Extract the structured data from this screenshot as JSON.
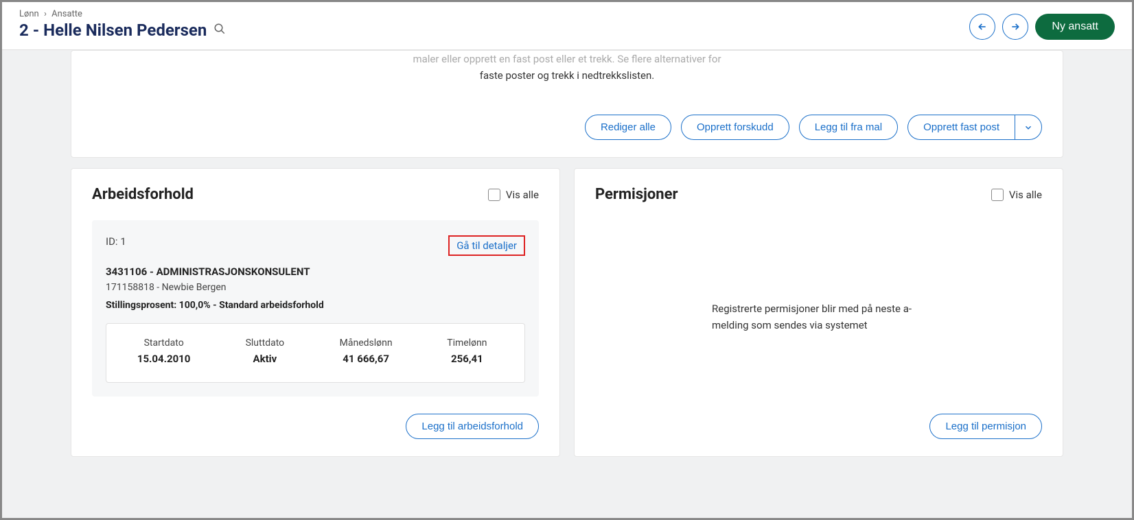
{
  "breadcrumb": {
    "root": "Lønn",
    "current": "Ansatte"
  },
  "page": {
    "title": "2 - Helle Nilsen Pedersen"
  },
  "header": {
    "ny_ansatt": "Ny ansatt"
  },
  "top_card": {
    "text_line1": "maler eller opprett en fast post eller et trekk. Se flere alternativer for",
    "text_line2": "faste poster og trekk i nedtrekkslisten.",
    "rediger_alle": "Rediger alle",
    "opprett_forskudd": "Opprett forskudd",
    "legg_til_mal": "Legg til fra mal",
    "opprett_fast_post": "Opprett fast post"
  },
  "arbeidsforhold": {
    "title": "Arbeidsforhold",
    "vis_alle": "Vis alle",
    "id_label": "ID: 1",
    "details_link": "Gå til detaljer",
    "position": "3431106 - ADMINISTRASJONSKONSULENT",
    "org": "171158818 - Newbie Bergen",
    "percent": "Stillingsprosent: 100,0% - Standard arbeidsforhold",
    "stats": {
      "startdato_label": "Startdato",
      "startdato_value": "15.04.2010",
      "sluttdato_label": "Sluttdato",
      "sluttdato_value": "Aktiv",
      "manedslonn_label": "Månedslønn",
      "manedslonn_value": "41 666,67",
      "timelonn_label": "Timelønn",
      "timelonn_value": "256,41"
    },
    "legg_til": "Legg til arbeidsforhold"
  },
  "permisjoner": {
    "title": "Permisjoner",
    "vis_alle": "Vis alle",
    "empty_text": "Registrerte permisjoner blir med på neste a-melding som sendes via systemet",
    "legg_til": "Legg til permisjon"
  }
}
